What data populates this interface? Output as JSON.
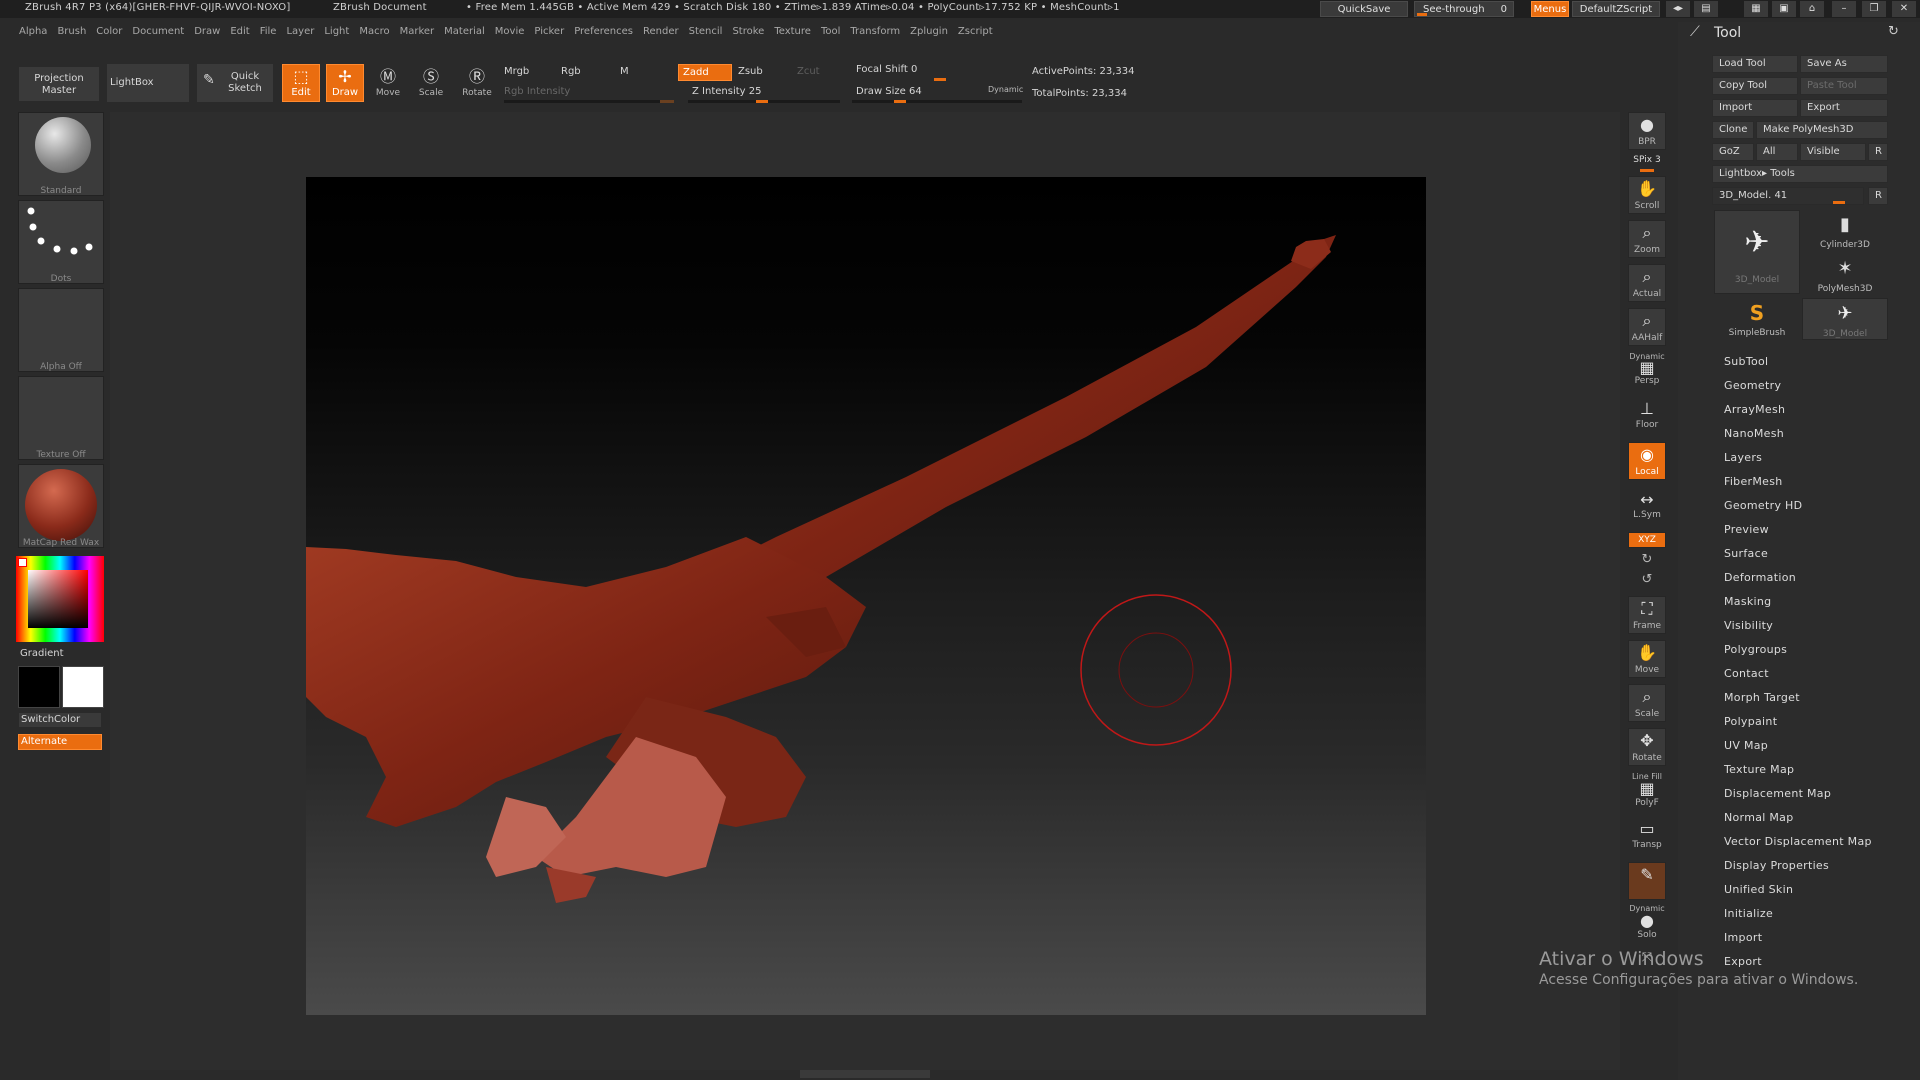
{
  "titlebar": {
    "app": "ZBrush 4R7 P3 (x64)[GHER-FHVF-QIJR-WVOI-NOXO]",
    "doc": "ZBrush Document",
    "stats": "• Free Mem 1.445GB • Active Mem 429 • Scratch Disk 180 •  ZTime▹1.839 ATime▹0.04 • PolyCount▹17.752 KP  • MeshCount▹1",
    "quicksave": "QuickSave",
    "seethrough": "See-through",
    "seethrough_value": "0",
    "menus": "Menus",
    "script": "DefaultZScript"
  },
  "menubar": [
    "Alpha",
    "Brush",
    "Color",
    "Document",
    "Draw",
    "Edit",
    "File",
    "Layer",
    "Light",
    "Macro",
    "Marker",
    "Material",
    "Movie",
    "Picker",
    "Preferences",
    "Render",
    "Stencil",
    "Stroke",
    "Texture",
    "Tool",
    "Transform",
    "Zplugin",
    "Zscript"
  ],
  "toolbar": {
    "projection_master": [
      "Projection",
      "Master"
    ],
    "lightbox": "LightBox",
    "quick_sketch": [
      "Quick",
      "Sketch"
    ],
    "edit": "Edit",
    "draw": "Draw",
    "move": "Move",
    "scale": "Scale",
    "rotate": "Rotate",
    "mrgb": "Mrgb",
    "rgb": "Rgb",
    "m": "M",
    "rgb_intensity": "Rgb Intensity",
    "zadd": "Zadd",
    "zsub": "Zsub",
    "zcut": "Zcut",
    "z_intensity_label": "Z Intensity",
    "z_intensity_value": "25",
    "focal_shift_label": "Focal Shift",
    "focal_shift_value": "0",
    "draw_size_label": "Draw Size",
    "draw_size_value": "64",
    "dynamic": "Dynamic",
    "active_points": "ActivePoints: 23,334",
    "total_points": "TotalPoints: 23,334"
  },
  "left_shelf": {
    "brush": "Standard",
    "stroke": "Dots",
    "alpha": "Alpha  Off",
    "texture": "Texture  Off",
    "material": "MatCap  Red  Wax",
    "gradient": "Gradient",
    "switchcolor": "SwitchColor",
    "alternate": "Alternate"
  },
  "right_shelf": {
    "bpr": "BPR",
    "spix_label": "SPix",
    "spix_value": "3",
    "scroll": "Scroll",
    "zoom": "Zoom",
    "actual": "Actual",
    "aahalf": "AAHalf",
    "persp_top": "Dynamic",
    "persp": "Persp",
    "floor": "Floor",
    "local": "Local",
    "lsym": "L.Sym",
    "xyz": "XYZ",
    "frame": "Frame",
    "move": "Move",
    "scale": "Scale",
    "rotate": "Rotate",
    "linefill": "Line Fill",
    "polyf": "PolyF",
    "transp": "Transp",
    "solo_top": "Dynamic",
    "solo": "Solo"
  },
  "tool_palette": {
    "title": "Tool",
    "load_tool": "Load Tool",
    "save_as": "Save As",
    "copy_tool": "Copy Tool",
    "paste_tool": "Paste Tool",
    "import": "Import",
    "export": "Export",
    "clone": "Clone",
    "make_polymesh": "Make PolyMesh3D",
    "goz": "GoZ",
    "all": "All",
    "visible": "Visible",
    "r": "R",
    "lightbox_tools": "Lightbox▸ Tools",
    "current_tool": "3D_Model. 41",
    "r2": "R",
    "thumbs": [
      "3D_Model",
      "Cylinder3D",
      "PolyMesh3D",
      "SimpleBrush",
      "3D_Model"
    ],
    "subpalettes": [
      "SubTool",
      "Geometry",
      "ArrayMesh",
      "NanoMesh",
      "Layers",
      "FiberMesh",
      "Geometry HD",
      "Preview",
      "Surface",
      "Deformation",
      "Masking",
      "Visibility",
      "Polygroups",
      "Contact",
      "Morph Target",
      "Polypaint",
      "UV Map",
      "Texture Map",
      "Displacement Map",
      "Normal Map",
      "Vector Displacement Map",
      "Display Properties",
      "Unified Skin",
      "Initialize",
      "Import",
      "Export"
    ]
  },
  "watermark": {
    "line1": "Ativar o Windows",
    "line2": "Acesse Configurações para ativar o Windows."
  },
  "colors": {
    "accent": "#ea6d10",
    "model": "#8a2a1a",
    "brush_ring": "#c01818"
  }
}
